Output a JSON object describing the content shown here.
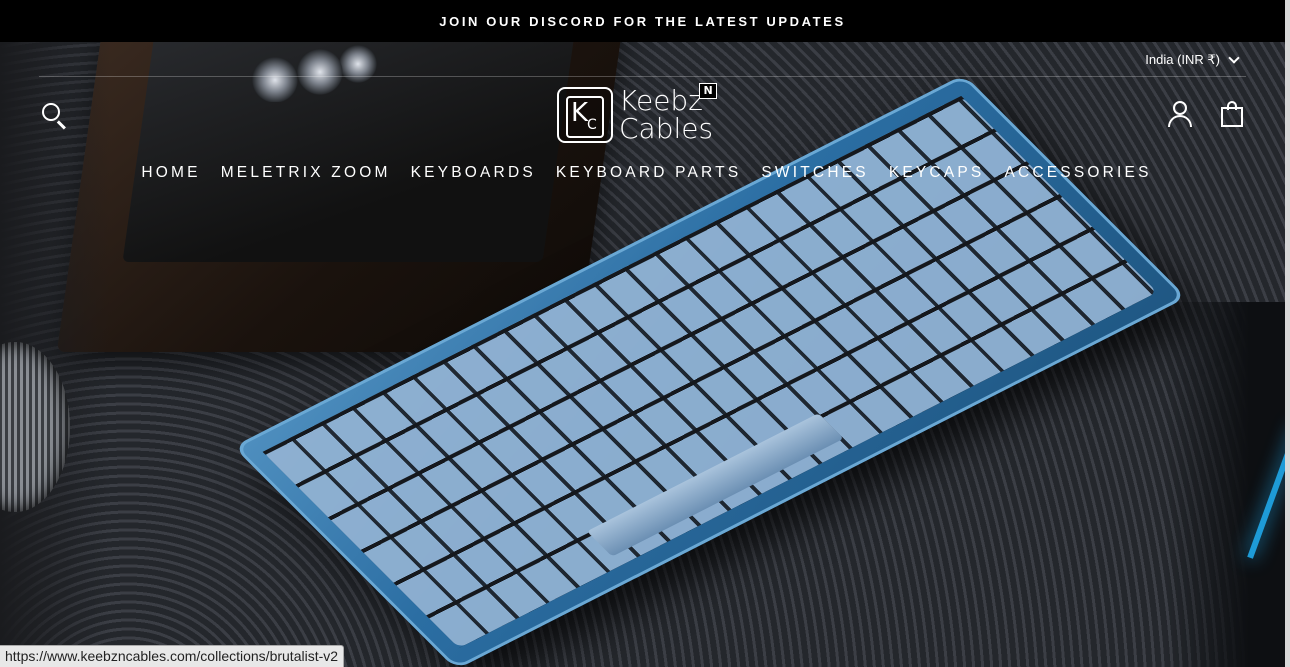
{
  "announcement": {
    "text": "JOIN OUR DISCORD FOR THE LATEST UPDATES"
  },
  "header": {
    "currency": "India (INR ₹)",
    "logo": {
      "badge_k": "K",
      "badge_c": "C",
      "line1": "Keebz",
      "line2": "Cables",
      "n_badge": "N"
    }
  },
  "nav": {
    "items": [
      {
        "label": "HOME"
      },
      {
        "label": "MELETRIX ZOOM"
      },
      {
        "label": "KEYBOARDS"
      },
      {
        "label": "KEYBOARD PARTS"
      },
      {
        "label": "SWITCHES"
      },
      {
        "label": "KEYCAPS"
      },
      {
        "label": "ACCESSORIES"
      }
    ]
  },
  "icons": {
    "search": "search-icon",
    "account": "account-icon",
    "cart": "cart-icon",
    "currency_dropdown": "chevron-down-icon"
  },
  "status_bar": {
    "url": "https://www.keebzncables.com/collections/brutalist-v2"
  },
  "colors": {
    "announcement_bg": "#000000",
    "accent_blue": "#2b6ea3"
  }
}
